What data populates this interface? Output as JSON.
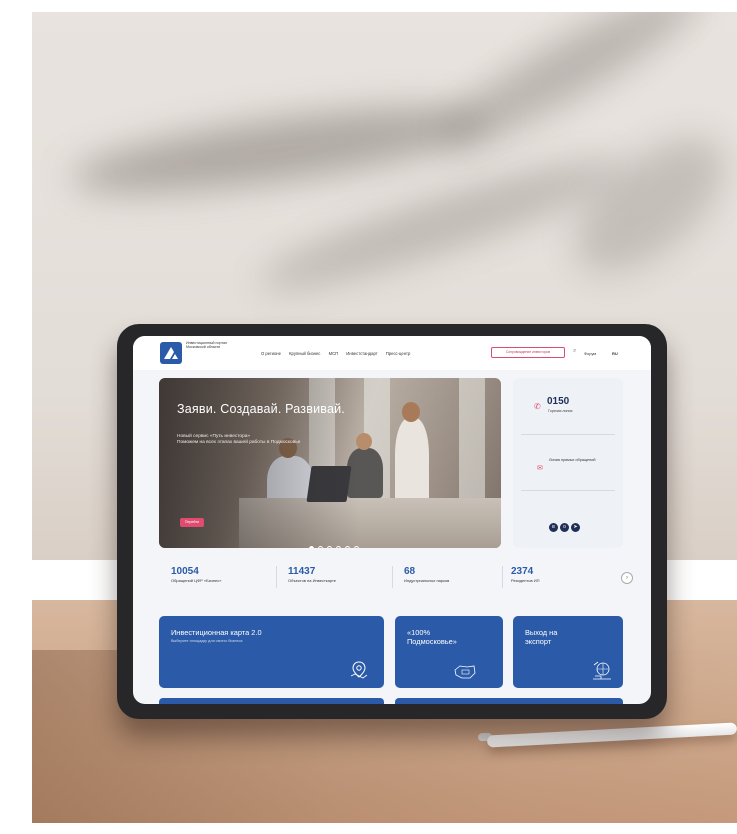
{
  "colors": {
    "brand_blue": "#2b5ba8",
    "accent_pink": "#e04b6f",
    "dark_navy": "#1f2f55"
  },
  "header": {
    "brand": "Инвестиционный портал Московской области",
    "nav": [
      "О регионе",
      "Крупный бизнес",
      "МСП",
      "Инвестстандарт",
      "Пресс-центр"
    ],
    "cta": "Сопровождение инвесторов",
    "forum": "Форум",
    "lang": "RU",
    "icons": [
      "logo-icon",
      "search-icon"
    ]
  },
  "hero": {
    "title": "Заяви. Создавай. Развивай.",
    "subtitle_line1": "Новый сервис «Путь инвестора»",
    "subtitle_line2": "Поможем на всех этапах вашей работы в Подмосковье",
    "button": "Перейти"
  },
  "contact": {
    "phone": "0150",
    "phone_label": "Горячая линия",
    "requests_label": "Линия прямых обращений",
    "icons": [
      "phone-icon",
      "message-icon",
      "vk-icon",
      "ok-icon",
      "telegram-icon"
    ]
  },
  "stats": [
    {
      "value": "10054",
      "label": "Обращений ЦФР «Бизнес»"
    },
    {
      "value": "11437",
      "label": "Объектов на Инвесткарте"
    },
    {
      "value": "68",
      "label": "Индустриальных парков"
    },
    {
      "value": "2374",
      "label": "Резидентов ИП"
    }
  ],
  "cards": [
    {
      "title": "Инвестиционная карта 2.0",
      "subtitle": "Выберите площадку для своего бизнеса",
      "icon": "map-pin-icon"
    },
    {
      "title_line1": "«100%",
      "title_line2": "Подмосковье»",
      "icon": "region-map-icon"
    },
    {
      "title_line1": "Выход на",
      "title_line2": "экспорт",
      "icon": "export-icon"
    }
  ]
}
